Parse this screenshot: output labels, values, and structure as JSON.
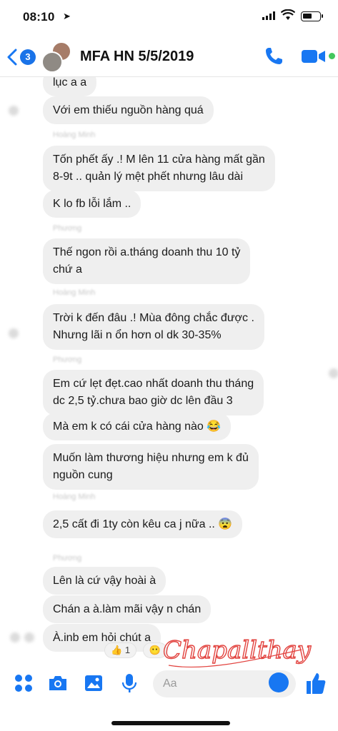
{
  "status_bar": {
    "time": "08:10",
    "location_glyph": "➤"
  },
  "header": {
    "back_badge": "3",
    "title": "MFA HN 5/5/2019"
  },
  "messages": [
    {
      "text": "lục a a"
    },
    {
      "text": "Với em thiếu nguồn hàng quá"
    },
    {
      "sender": "Hoàng Minh"
    },
    {
      "text": "Tốn phết ấy .! M lên 11 cửa hàng mất gần"
    },
    {
      "text": "8-9t .. quản lý mệt phết nhưng lâu dài"
    },
    {
      "text": "K lo fb lỗi lắm .."
    },
    {
      "sender": "Phương"
    },
    {
      "text": "Thế ngon rồi a.tháng doanh thu 10 tỷ"
    },
    {
      "text": "chứ a"
    },
    {
      "sender": "Hoàng Minh"
    },
    {
      "text": "Trời k đến đâu .! Mùa đông chắc được ."
    },
    {
      "text": "Nhưng lãi n ổn hơn ol dk 30-35%"
    },
    {
      "sender": "Phương"
    },
    {
      "text": "Em cứ lẹt đẹt.cao nhất doanh thu tháng"
    },
    {
      "text": "dc 2,5 tỷ.chưa bao giờ dc lên đầu 3"
    },
    {
      "text": "Mà em k có cái cửa hàng nào 😂"
    },
    {
      "text": "Muốn làm thương hiệu nhưng em k đủ"
    },
    {
      "text": "nguồn cung"
    },
    {
      "sender": "Hoàng Minh"
    },
    {
      "text": "2,5 cất đi 1ty còn kêu ca j nữa .. 😨"
    },
    {
      "sender": "Phương"
    },
    {
      "text": "Lên là cứ vậy hoài à"
    },
    {
      "text": "Chán a à.làm mãi vậy n chán"
    },
    {
      "text": "À.inb em hỏi chút a"
    }
  ],
  "reactions": [
    {
      "emoji": "👍",
      "count": "1"
    },
    {
      "emoji": "😶",
      "count": ""
    }
  ],
  "signature": {
    "text": "Chapallthay",
    "color": "#e2433f"
  },
  "composer": {
    "placeholder": "Aa"
  },
  "colors": {
    "accent": "#1877f2",
    "bubble": "#efefef",
    "online": "#43c75d"
  },
  "icons": [
    "back-chevron-icon",
    "phone-icon",
    "video-camera-icon",
    "apps-grid-icon",
    "camera-icon",
    "gallery-icon",
    "microphone-icon",
    "emoji-icon",
    "thumbs-up-icon"
  ]
}
